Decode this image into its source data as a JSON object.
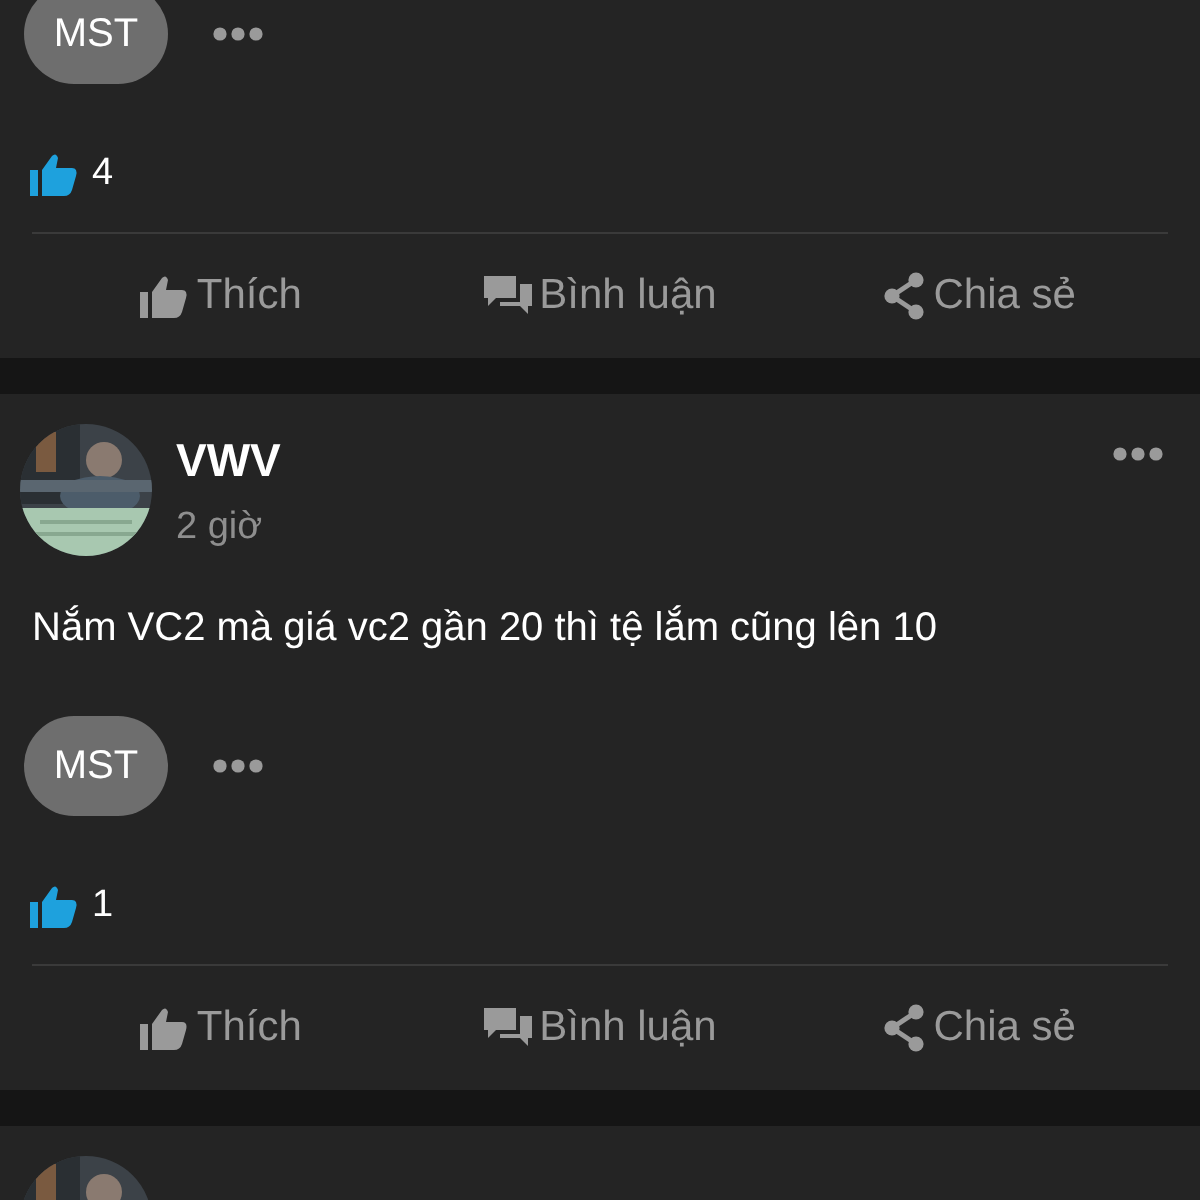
{
  "posts": [
    {
      "reaction_chip": "MST",
      "likes": "4",
      "actions": [
        "Thích",
        "Bình luận",
        "Chia sẻ"
      ]
    },
    {
      "avatar": {
        "kind": "picture"
      },
      "author": "VWV",
      "time": "2 giờ",
      "text": "Nắm VC2 mà giá vc2 gần 20 thì tệ lắm cũng lên 10",
      "reaction_chip": "MST",
      "likes": "1",
      "actions": [
        "Thích",
        "Bình luận",
        "Chia sẻ"
      ]
    },
    {
      "avatar": {
        "kind": "picture"
      }
    }
  ]
}
